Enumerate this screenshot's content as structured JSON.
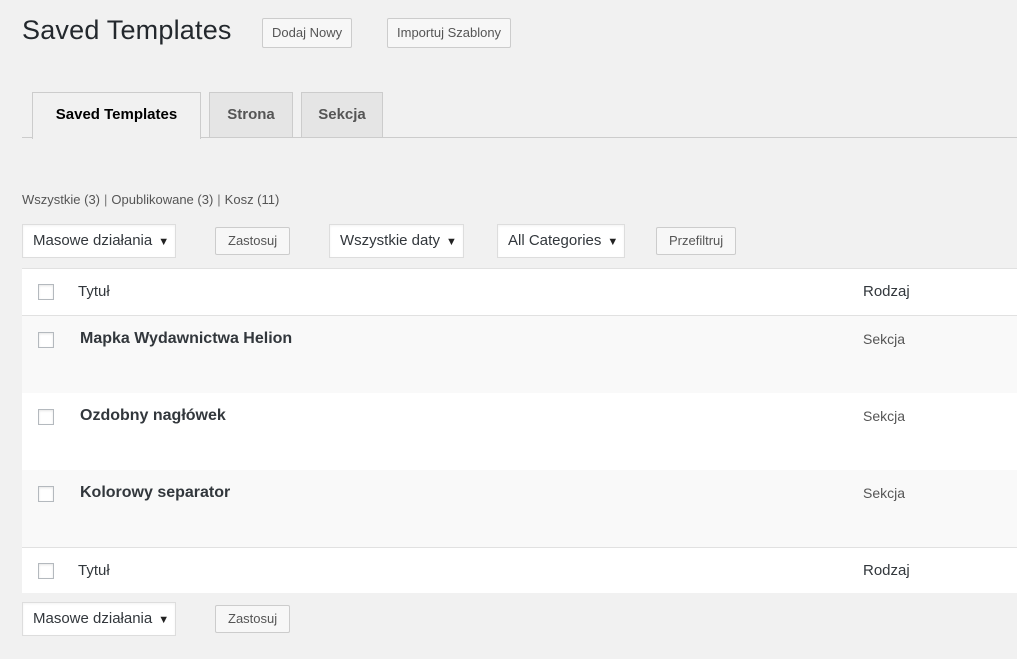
{
  "header": {
    "title": "Saved Templates",
    "add_new": "Dodaj Nowy",
    "import": "Importuj Szablony"
  },
  "tabs": [
    {
      "label": "Saved Templates",
      "active": true
    },
    {
      "label": "Strona",
      "active": false
    },
    {
      "label": "Sekcja",
      "active": false
    }
  ],
  "views": {
    "all": "Wszystkie (3)",
    "published": "Opublikowane (3)",
    "trash": "Kosz (11)",
    "separator": "|"
  },
  "tablenav_top": {
    "bulk_actions": "Masowe działania",
    "apply": "Zastosuj",
    "dates": "Wszystkie daty",
    "categories": "All Categories",
    "filter": "Przefiltruj"
  },
  "table": {
    "columns": {
      "title": "Tytuł",
      "type": "Rodzaj"
    },
    "rows": [
      {
        "title": "Mapka Wydawnictwa Helion",
        "type": "Sekcja"
      },
      {
        "title": "Ozdobny nagłówek",
        "type": "Sekcja"
      },
      {
        "title": "Kolorowy separator",
        "type": "Sekcja"
      }
    ]
  },
  "tablenav_bottom": {
    "bulk_actions": "Masowe działania",
    "apply": "Zastosuj"
  },
  "icons": {
    "dropdown_arrow": "triangle-down-icon"
  }
}
